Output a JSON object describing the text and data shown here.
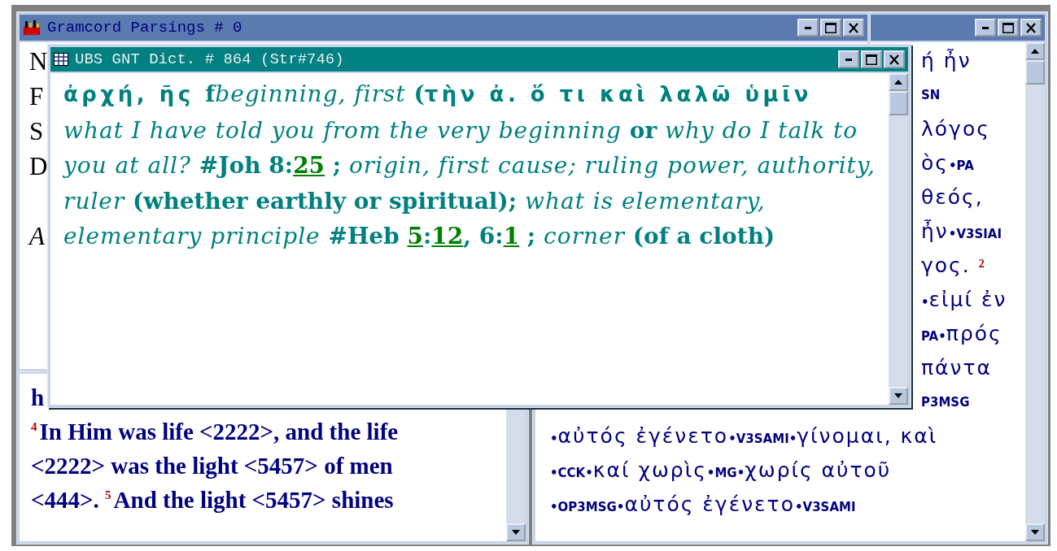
{
  "parsings_window": {
    "title": "Gramcord Parsings # 0",
    "letters": [
      "N",
      "F",
      "S",
      "D"
    ],
    "italic_letter": "A"
  },
  "dictionary_window": {
    "title": "UBS GNT Dict. # 864 (Str#746)",
    "entry": [
      {
        "kind": "greek",
        "text": "ἀρχή, ῆς "
      },
      {
        "kind": "plain",
        "text": "f"
      },
      {
        "kind": "italic",
        "text": "beginning, first"
      },
      {
        "kind": "plain",
        "text": " ("
      },
      {
        "kind": "greek",
        "text": "τὴν ἀ. ὅ τι καὶ λαλῶ ὑμῖν"
      },
      {
        "kind": "italic",
        "text": " what I have told you from the very beginning"
      },
      {
        "kind": "plain",
        "text": " or "
      },
      {
        "kind": "italic",
        "text": "why do I talk to you at all?"
      },
      {
        "kind": "plain",
        "text": " #Joh 8:"
      },
      {
        "kind": "link",
        "text": "25"
      },
      {
        "kind": "plain",
        "text": " ; "
      },
      {
        "kind": "italic",
        "text": "origin, first cause; ruling power, authority, ruler"
      },
      {
        "kind": "plain",
        "text": " (whether earthly or spiritual);"
      },
      {
        "kind": "italic",
        "text": " what is elementary, elementary principle"
      },
      {
        "kind": "plain",
        "text": " #Heb "
      },
      {
        "kind": "link",
        "text": "5"
      },
      {
        "kind": "plain",
        "text": ":"
      },
      {
        "kind": "link",
        "text": "12"
      },
      {
        "kind": "plain",
        "text": ", 6:"
      },
      {
        "kind": "link",
        "text": "1"
      },
      {
        "kind": "plain",
        "text": " ;"
      },
      {
        "kind": "italic",
        "text": " corner"
      },
      {
        "kind": "plain",
        "text": " (of a cloth)"
      }
    ]
  },
  "verse_window": {
    "lines": [
      [
        {
          "kind": "text",
          "text": "h"
        }
      ],
      [
        {
          "kind": "verse",
          "text": "4"
        },
        {
          "kind": "text",
          "text": "In Him was life <2222>, and the life"
        }
      ],
      [
        {
          "kind": "text",
          "text": "<2222> was the light <5457> of men"
        }
      ],
      [
        {
          "kind": "text",
          "text": "<444>. "
        },
        {
          "kind": "verse",
          "text": "5"
        },
        {
          "kind": "text",
          "text": "And the light <5457> shines"
        }
      ]
    ]
  },
  "text_window": {
    "upper_lines": [
      [
        {
          "kind": "greek",
          "text": "ή ἦν"
        }
      ],
      [
        {
          "kind": "code",
          "text": "SN"
        }
      ],
      [
        {
          "kind": "greek",
          "text": " λόγος"
        }
      ],
      [
        {
          "kind": "greek",
          "text": "ὸς"
        },
        {
          "kind": "code",
          "text": "•PA"
        }
      ],
      [
        {
          "kind": "greek",
          "text": "θεός,"
        }
      ],
      [
        {
          "kind": "greek",
          "text": "ἦν"
        },
        {
          "kind": "code",
          "text": "•V3SIAI"
        }
      ],
      [
        {
          "kind": "greek",
          "text": "γος. "
        },
        {
          "kind": "verse",
          "text": "2"
        }
      ],
      [
        {
          "kind": "code",
          "text": "•"
        },
        {
          "kind": "greek",
          "text": "εἰμί ἐν"
        }
      ],
      [
        {
          "kind": "code",
          "text": "PA•"
        },
        {
          "kind": "greek",
          "text": "πρός"
        }
      ],
      [
        {
          "kind": "greek",
          "text": " πάντα"
        }
      ],
      [
        {
          "kind": "code",
          "text": "P3MSG"
        }
      ]
    ],
    "lower_lines": [
      [
        {
          "kind": "code",
          "text": "•"
        },
        {
          "kind": "greek",
          "text": "αὐτός ἐγένετο"
        },
        {
          "kind": "code",
          "text": "•V3SAMI•"
        },
        {
          "kind": "greek",
          "text": "γίνομαι, καὶ"
        }
      ],
      [
        {
          "kind": "code",
          "text": "•CCK•"
        },
        {
          "kind": "greek",
          "text": "καί χωρὶς"
        },
        {
          "kind": "code",
          "text": "•MG•"
        },
        {
          "kind": "greek",
          "text": "χωρίς αὐτοῦ"
        }
      ],
      [
        {
          "kind": "code",
          "text": "•OP3MSG•"
        },
        {
          "kind": "greek",
          "text": "αὐτός ἐγένετο"
        },
        {
          "kind": "code",
          "text": "•V3SAMI"
        }
      ]
    ]
  }
}
